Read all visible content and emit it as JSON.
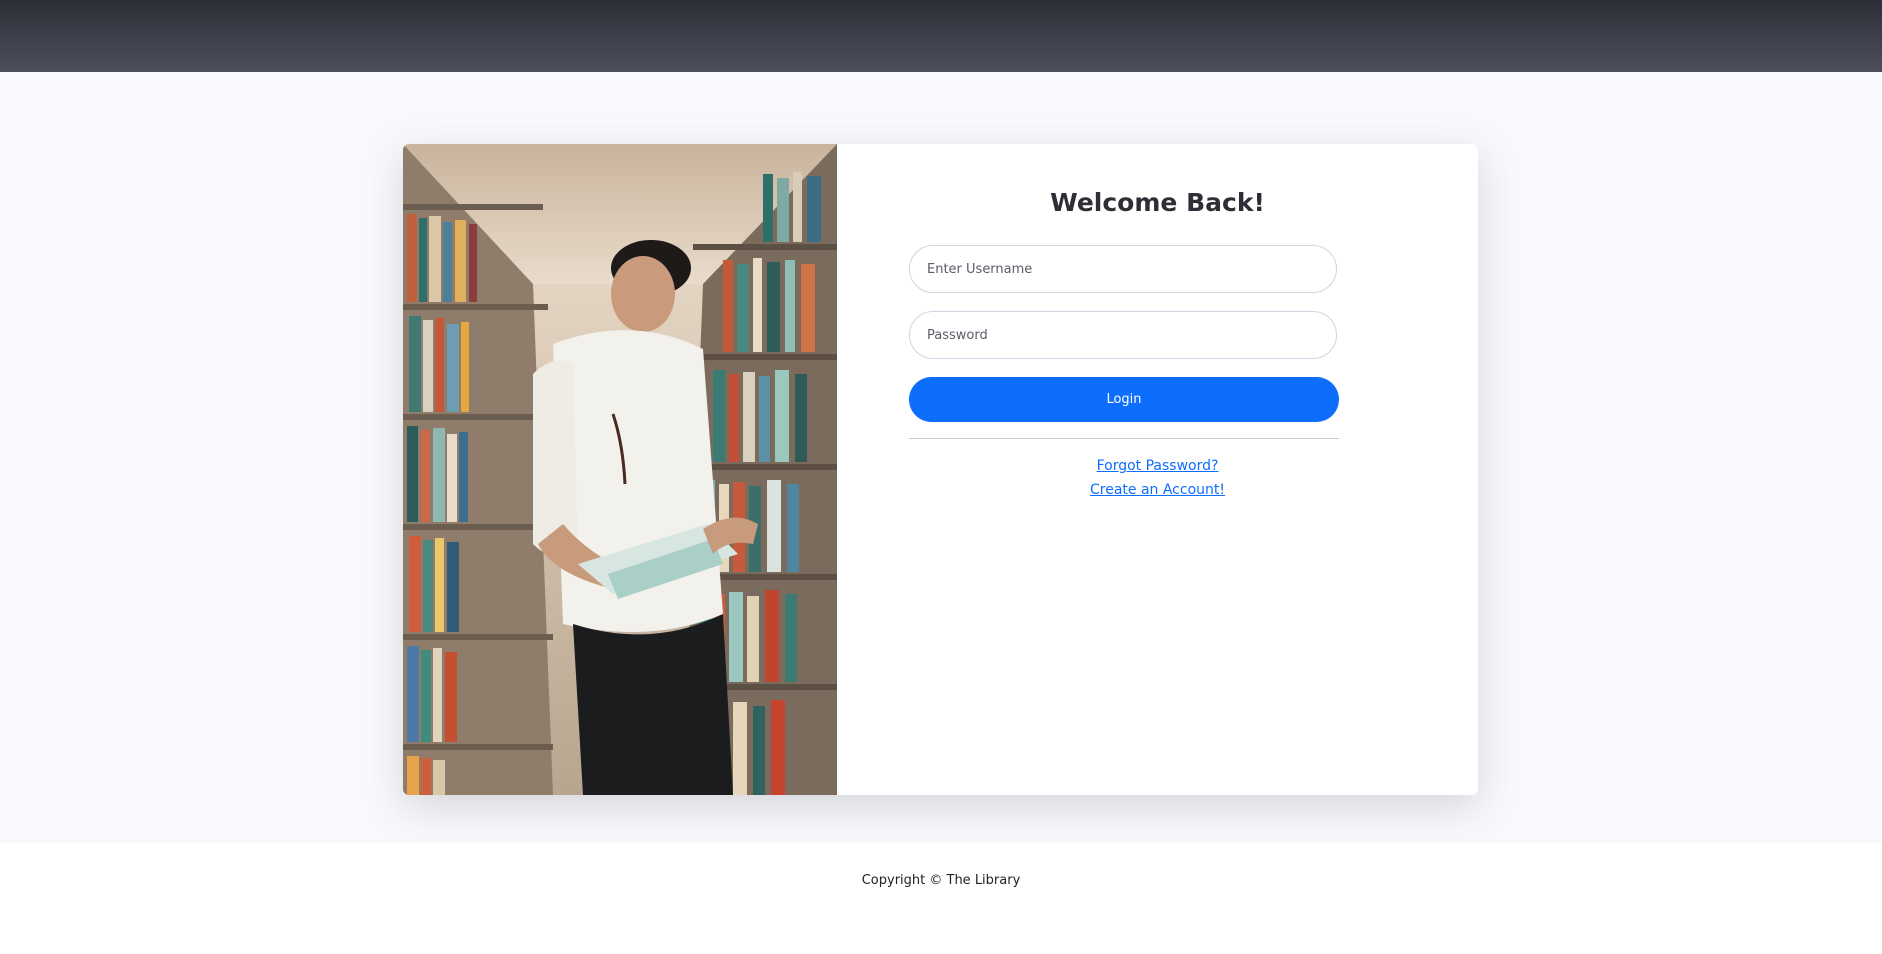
{
  "login": {
    "title": "Welcome Back!",
    "username_placeholder": "Enter Username",
    "password_placeholder": "Password",
    "login_label": "Login",
    "forgot_password": "Forgot Password?",
    "create_account": "Create an Account!"
  },
  "footer": {
    "copyright": "Copyright © The Library"
  },
  "colors": {
    "primary": "#0d6efd",
    "background": "#f8f9fc",
    "topbar": "#3b3d47"
  }
}
